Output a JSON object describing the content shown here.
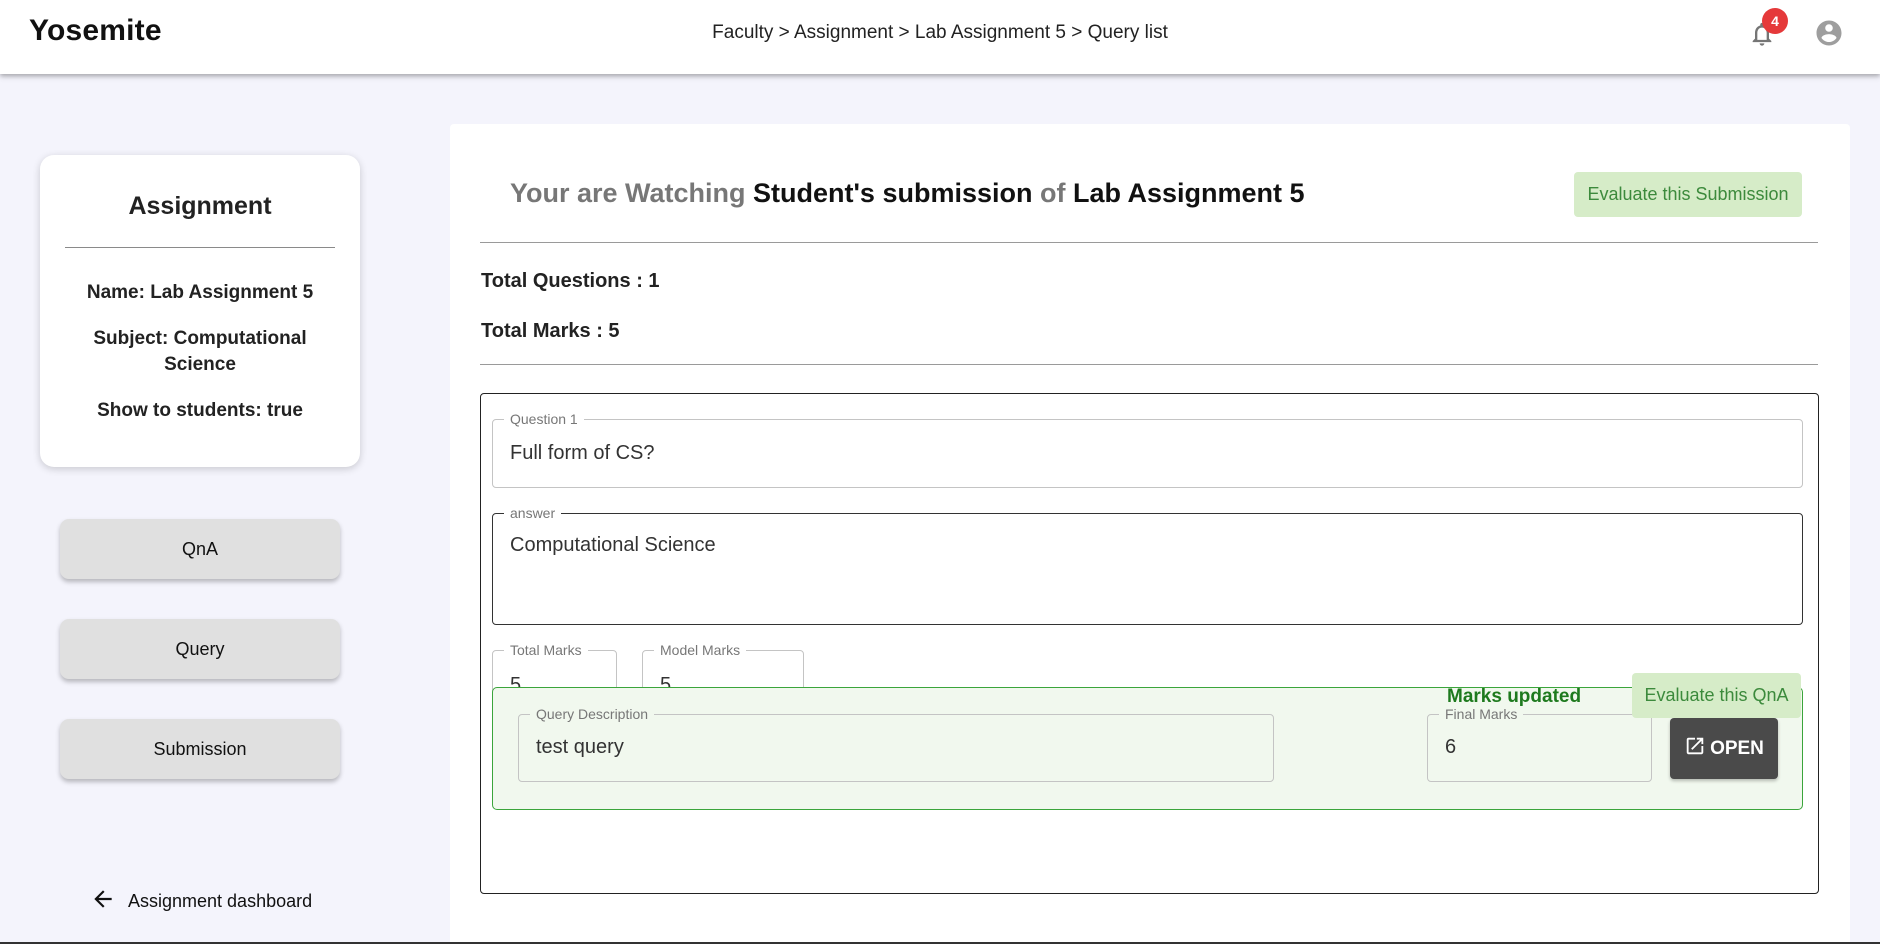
{
  "header": {
    "brand": "Yosemite",
    "breadcrumb": "Faculty > Assignment > Lab Assignment 5 > Query list",
    "notification_count": "4",
    "icons": [
      "bell-icon",
      "account-circle-icon"
    ]
  },
  "sidebar": {
    "card_title": "Assignment",
    "name": "Name: Lab Assignment 5",
    "subject": "Subject: Computational Science",
    "show": "Show to students: true",
    "buttons": {
      "qna": "QnA",
      "query": "Query",
      "submission": "Submission"
    },
    "back_label": "Assignment dashboard"
  },
  "main": {
    "heading": {
      "part1": "Your are Watching ",
      "part2": "Student's submission",
      "part3": " of ",
      "part4": "Lab Assignment 5"
    },
    "evaluate_submission": "Evaluate this Submission",
    "total_questions": "Total Questions : 1",
    "total_marks": "Total Marks : 5",
    "qna": {
      "question_label": "Question 1",
      "question_value": "Full form of CS?",
      "answer_label": "answer",
      "answer_value": "Computational Science",
      "total_marks_label": "Total Marks",
      "total_marks_value": "5",
      "model_marks_label": "Model Marks",
      "model_marks_value": "5",
      "status": "Marks updated",
      "evaluate_qna": "Evaluate this QnA"
    },
    "query": {
      "description_label": "Query Description",
      "description_value": "test query",
      "final_marks_label": "Final Marks",
      "final_marks_value": "6",
      "open_label": "OPEN"
    }
  },
  "colors": {
    "accent_green": "#3ba53b",
    "evaluate_bg": "#d6ecc8",
    "badge_red": "#e5393a",
    "status_green": "#1e7a1e"
  }
}
